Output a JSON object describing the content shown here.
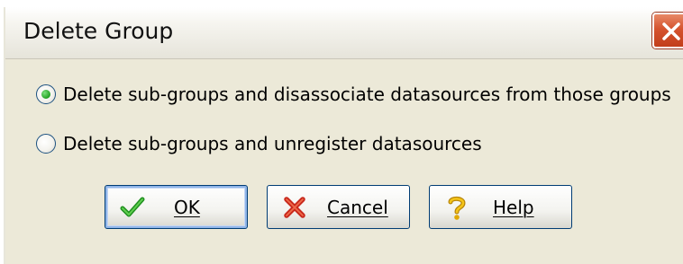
{
  "window": {
    "title": "Delete Group",
    "close_icon": "close-x-icon"
  },
  "options": [
    {
      "label": "Delete sub-groups and disassociate datasources from those groups",
      "selected": true
    },
    {
      "label": "Delete sub-groups and unregister datasources",
      "selected": false
    }
  ],
  "buttons": {
    "ok": {
      "label": "OK",
      "icon": "checkmark-icon"
    },
    "cancel": {
      "label": "Cancel",
      "icon": "red-x-icon"
    },
    "help": {
      "label": "Help",
      "icon": "question-mark-icon"
    }
  },
  "colors": {
    "dialog_bg": "#ece9d8",
    "button_border": "#003c74",
    "close_button": "#d5532e",
    "radio_dot": "#21a121"
  }
}
